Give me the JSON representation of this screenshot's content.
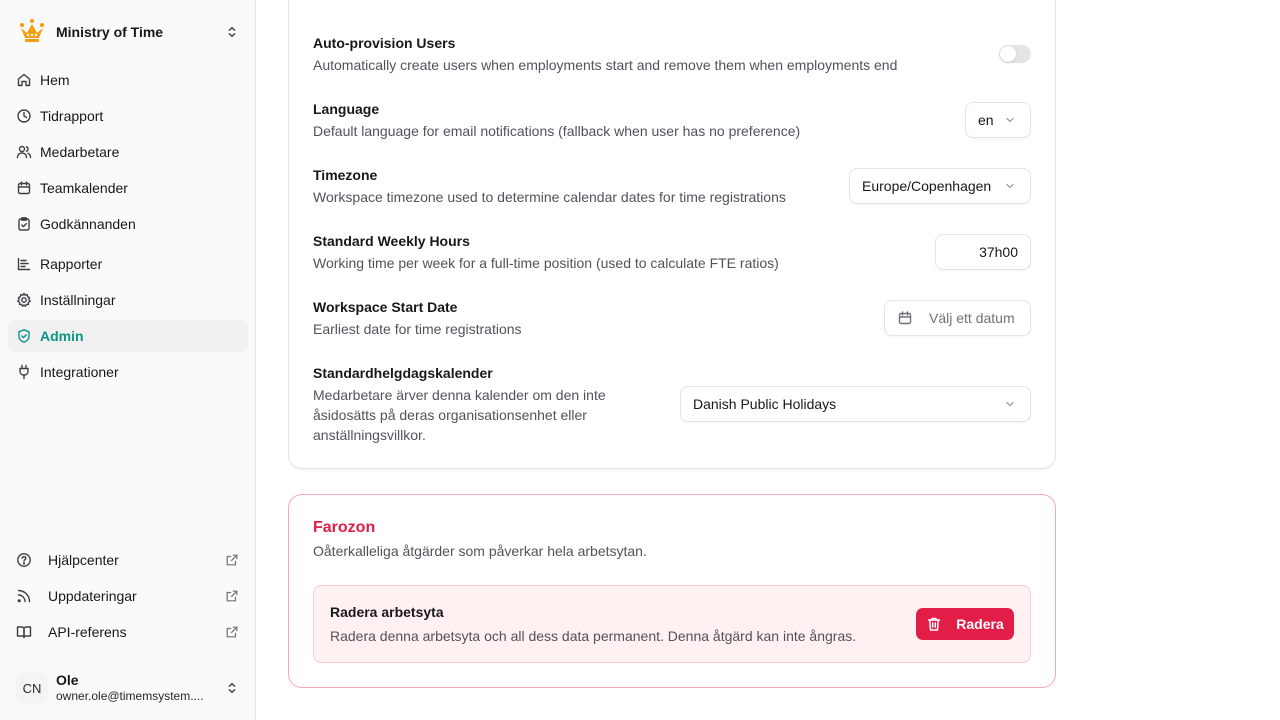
{
  "workspace": {
    "name": "Ministry of Time",
    "logo_icon": "crown-icon",
    "brand_color": "#f59e0b"
  },
  "sidebar": {
    "items": [
      {
        "label": "Hem",
        "icon": "home-icon"
      },
      {
        "label": "Tidrapport",
        "icon": "clock-icon"
      },
      {
        "label": "Medarbetare",
        "icon": "users-icon"
      },
      {
        "label": "Teamkalender",
        "icon": "calendar-icon"
      },
      {
        "label": "Godkännanden",
        "icon": "clipboard-check-icon"
      },
      {
        "label": "Rapporter",
        "icon": "chart-icon"
      },
      {
        "label": "Inställningar",
        "icon": "gear-icon"
      },
      {
        "label": "Admin",
        "icon": "shield-check-icon",
        "active": true
      },
      {
        "label": "Integrationer",
        "icon": "plug-icon"
      }
    ],
    "bottom": [
      {
        "label": "Hjälpcenter",
        "icon": "help-circle-icon"
      },
      {
        "label": "Uppdateringar",
        "icon": "rss-icon"
      },
      {
        "label": "API-referens",
        "icon": "book-icon"
      }
    ],
    "user": {
      "initials": "CN",
      "name": "Ole",
      "email": "owner.ole@timemsystem...."
    }
  },
  "settings": {
    "auto_provision": {
      "title": "Auto-provision Users",
      "desc": "Automatically create users when employments start and remove them when employments end",
      "enabled": false
    },
    "language": {
      "title": "Language",
      "desc": "Default language for email notifications (fallback when user has no preference)",
      "value": "en"
    },
    "timezone": {
      "title": "Timezone",
      "desc": "Workspace timezone used to determine calendar dates for time registrations",
      "value": "Europe/Copenhagen"
    },
    "weekly_hours": {
      "title": "Standard Weekly Hours",
      "desc": "Working time per week for a full-time position (used to calculate FTE ratios)",
      "value": "37h00"
    },
    "start_date": {
      "title": "Workspace Start Date",
      "desc": "Earliest date for time registrations",
      "placeholder": "Välj ett datum"
    },
    "holiday_calendar": {
      "title": "Standardhelgdagskalender",
      "desc_lines": [
        "Medarbetare ärver denna kalender om den inte",
        "åsidosätts på deras organisationsenhet eller",
        "anställningsvillkor."
      ],
      "value": "Danish Public Holidays"
    }
  },
  "danger_zone": {
    "title": "Farozon",
    "desc": "Oåterkalleliga åtgärder som påverkar hela arbetsytan.",
    "delete": {
      "title": "Radera arbetsyta",
      "desc": "Radera denna arbetsyta och all dess data permanent. Denna åtgärd kan inte ångras.",
      "button": "Radera"
    },
    "color": "#e11d48"
  },
  "accent_color": "#0d9488"
}
